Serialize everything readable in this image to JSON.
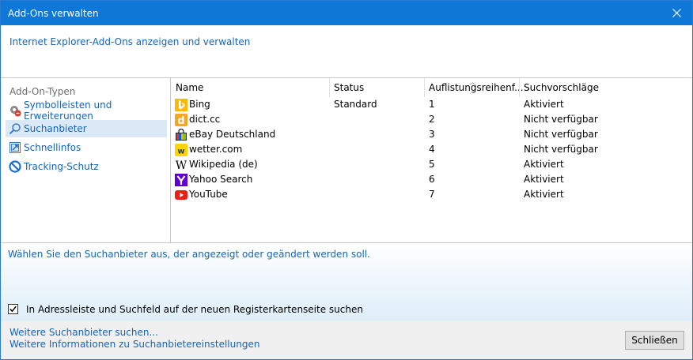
{
  "window": {
    "title": "Add-Ons verwalten"
  },
  "header": {
    "subtitle": "Internet Explorer-Add-Ons anzeigen und verwalten"
  },
  "sidebar": {
    "title": "Add-On-Typen",
    "items": [
      {
        "label": "Symbolleisten und Erweiterungen",
        "icon": "gear-icon"
      },
      {
        "label": "Suchanbieter",
        "icon": "search-icon",
        "selected": true
      },
      {
        "label": "Schnellinfos",
        "icon": "accelerator-icon"
      },
      {
        "label": "Tracking-Schutz",
        "icon": "tracking-protection-icon"
      }
    ]
  },
  "list": {
    "columns": [
      "Name",
      "Status",
      "Auflistungsreihenf...",
      "Suchvorschläge"
    ],
    "rows": [
      {
        "name": "Bing",
        "status": "Standard",
        "order": "1",
        "suggestions": "Aktiviert",
        "icon": "bing-icon"
      },
      {
        "name": "dict.cc",
        "status": "",
        "order": "2",
        "suggestions": "Nicht verfügbar",
        "icon": "dictcc-icon"
      },
      {
        "name": "eBay Deutschland",
        "status": "",
        "order": "3",
        "suggestions": "Nicht verfügbar",
        "icon": "ebay-icon"
      },
      {
        "name": "wetter.com",
        "status": "",
        "order": "4",
        "suggestions": "Nicht verfügbar",
        "icon": "wetter-icon"
      },
      {
        "name": "Wikipedia (de)",
        "status": "",
        "order": "5",
        "suggestions": "Aktiviert",
        "icon": "wikipedia-icon"
      },
      {
        "name": "Yahoo Search",
        "status": "",
        "order": "6",
        "suggestions": "Aktiviert",
        "icon": "yahoo-icon"
      },
      {
        "name": "YouTube",
        "status": "",
        "order": "7",
        "suggestions": "Aktiviert",
        "icon": "youtube-icon"
      }
    ]
  },
  "details": {
    "text": "Wählen Sie den Suchanbieter aus, der angezeigt oder geändert werden soll.",
    "checkbox_label": "In Adressleiste und Suchfeld auf der neuen Registerkartenseite suchen",
    "checkbox_checked": true
  },
  "footer": {
    "link1": "Weitere Suchanbieter suchen...",
    "link2": "Weitere Informationen zu Suchanbietereinstellungen",
    "close_button": "Schließen"
  },
  "colors": {
    "titlebar": "#0f78d7",
    "link": "#1565b8",
    "selection": "#dbe9f7"
  }
}
